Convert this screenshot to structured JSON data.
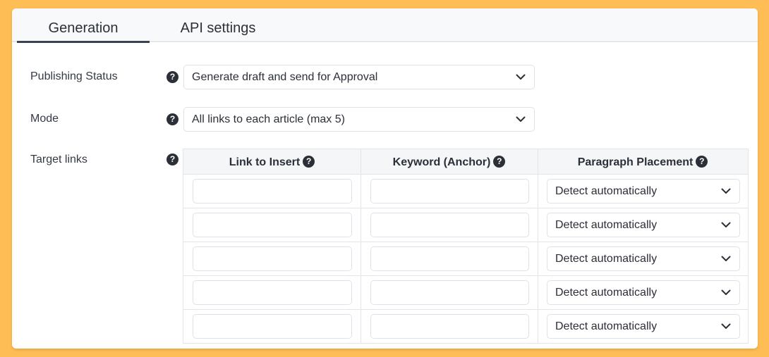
{
  "tabs": [
    {
      "label": "Generation",
      "active": true
    },
    {
      "label": "API settings",
      "active": false
    }
  ],
  "help_glyph": "?",
  "publishing": {
    "label": "Publishing Status",
    "value": "Generate draft and send for Approval"
  },
  "mode": {
    "label": "Mode",
    "value": "All links to each article (max 5)"
  },
  "target_links": {
    "label": "Target links",
    "columns": [
      "Link to Insert",
      "Keyword (Anchor)",
      "Paragraph Placement"
    ],
    "rows": [
      {
        "link": "",
        "keyword": "",
        "placement": "Detect automatically"
      },
      {
        "link": "",
        "keyword": "",
        "placement": "Detect automatically"
      },
      {
        "link": "",
        "keyword": "",
        "placement": "Detect automatically"
      },
      {
        "link": "",
        "keyword": "",
        "placement": "Detect automatically"
      },
      {
        "link": "",
        "keyword": "",
        "placement": "Detect automatically"
      }
    ]
  },
  "colors": {
    "background": "#ffbe55",
    "card": "#ffffff",
    "active_tab_underline": "#3a4356",
    "text": "#2b2f38"
  },
  "icons": {
    "help": "question-circle-icon",
    "dropdown": "chevron-down-icon"
  }
}
